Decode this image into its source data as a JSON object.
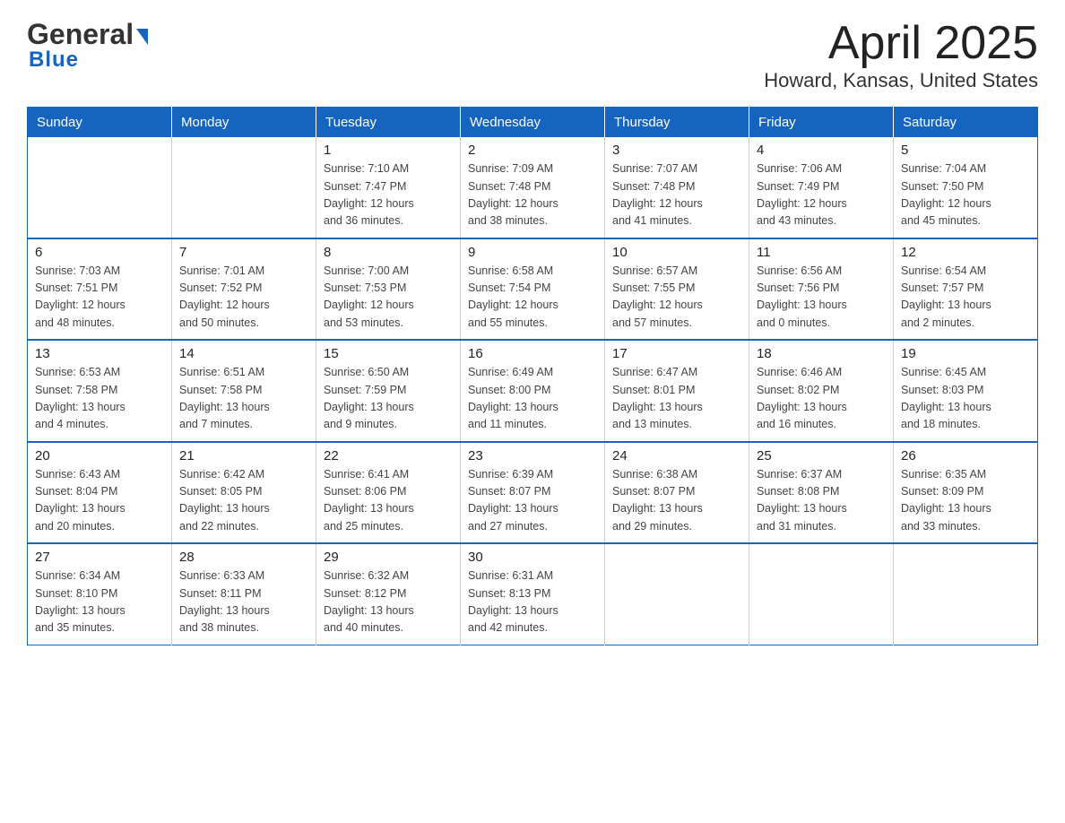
{
  "header": {
    "logo_general": "General",
    "logo_blue": "Blue",
    "title": "April 2025",
    "subtitle": "Howard, Kansas, United States"
  },
  "calendar": {
    "days_of_week": [
      "Sunday",
      "Monday",
      "Tuesday",
      "Wednesday",
      "Thursday",
      "Friday",
      "Saturday"
    ],
    "weeks": [
      [
        {
          "day": "",
          "detail": ""
        },
        {
          "day": "",
          "detail": ""
        },
        {
          "day": "1",
          "detail": "Sunrise: 7:10 AM\nSunset: 7:47 PM\nDaylight: 12 hours\nand 36 minutes."
        },
        {
          "day": "2",
          "detail": "Sunrise: 7:09 AM\nSunset: 7:48 PM\nDaylight: 12 hours\nand 38 minutes."
        },
        {
          "day": "3",
          "detail": "Sunrise: 7:07 AM\nSunset: 7:48 PM\nDaylight: 12 hours\nand 41 minutes."
        },
        {
          "day": "4",
          "detail": "Sunrise: 7:06 AM\nSunset: 7:49 PM\nDaylight: 12 hours\nand 43 minutes."
        },
        {
          "day": "5",
          "detail": "Sunrise: 7:04 AM\nSunset: 7:50 PM\nDaylight: 12 hours\nand 45 minutes."
        }
      ],
      [
        {
          "day": "6",
          "detail": "Sunrise: 7:03 AM\nSunset: 7:51 PM\nDaylight: 12 hours\nand 48 minutes."
        },
        {
          "day": "7",
          "detail": "Sunrise: 7:01 AM\nSunset: 7:52 PM\nDaylight: 12 hours\nand 50 minutes."
        },
        {
          "day": "8",
          "detail": "Sunrise: 7:00 AM\nSunset: 7:53 PM\nDaylight: 12 hours\nand 53 minutes."
        },
        {
          "day": "9",
          "detail": "Sunrise: 6:58 AM\nSunset: 7:54 PM\nDaylight: 12 hours\nand 55 minutes."
        },
        {
          "day": "10",
          "detail": "Sunrise: 6:57 AM\nSunset: 7:55 PM\nDaylight: 12 hours\nand 57 minutes."
        },
        {
          "day": "11",
          "detail": "Sunrise: 6:56 AM\nSunset: 7:56 PM\nDaylight: 13 hours\nand 0 minutes."
        },
        {
          "day": "12",
          "detail": "Sunrise: 6:54 AM\nSunset: 7:57 PM\nDaylight: 13 hours\nand 2 minutes."
        }
      ],
      [
        {
          "day": "13",
          "detail": "Sunrise: 6:53 AM\nSunset: 7:58 PM\nDaylight: 13 hours\nand 4 minutes."
        },
        {
          "day": "14",
          "detail": "Sunrise: 6:51 AM\nSunset: 7:58 PM\nDaylight: 13 hours\nand 7 minutes."
        },
        {
          "day": "15",
          "detail": "Sunrise: 6:50 AM\nSunset: 7:59 PM\nDaylight: 13 hours\nand 9 minutes."
        },
        {
          "day": "16",
          "detail": "Sunrise: 6:49 AM\nSunset: 8:00 PM\nDaylight: 13 hours\nand 11 minutes."
        },
        {
          "day": "17",
          "detail": "Sunrise: 6:47 AM\nSunset: 8:01 PM\nDaylight: 13 hours\nand 13 minutes."
        },
        {
          "day": "18",
          "detail": "Sunrise: 6:46 AM\nSunset: 8:02 PM\nDaylight: 13 hours\nand 16 minutes."
        },
        {
          "day": "19",
          "detail": "Sunrise: 6:45 AM\nSunset: 8:03 PM\nDaylight: 13 hours\nand 18 minutes."
        }
      ],
      [
        {
          "day": "20",
          "detail": "Sunrise: 6:43 AM\nSunset: 8:04 PM\nDaylight: 13 hours\nand 20 minutes."
        },
        {
          "day": "21",
          "detail": "Sunrise: 6:42 AM\nSunset: 8:05 PM\nDaylight: 13 hours\nand 22 minutes."
        },
        {
          "day": "22",
          "detail": "Sunrise: 6:41 AM\nSunset: 8:06 PM\nDaylight: 13 hours\nand 25 minutes."
        },
        {
          "day": "23",
          "detail": "Sunrise: 6:39 AM\nSunset: 8:07 PM\nDaylight: 13 hours\nand 27 minutes."
        },
        {
          "day": "24",
          "detail": "Sunrise: 6:38 AM\nSunset: 8:07 PM\nDaylight: 13 hours\nand 29 minutes."
        },
        {
          "day": "25",
          "detail": "Sunrise: 6:37 AM\nSunset: 8:08 PM\nDaylight: 13 hours\nand 31 minutes."
        },
        {
          "day": "26",
          "detail": "Sunrise: 6:35 AM\nSunset: 8:09 PM\nDaylight: 13 hours\nand 33 minutes."
        }
      ],
      [
        {
          "day": "27",
          "detail": "Sunrise: 6:34 AM\nSunset: 8:10 PM\nDaylight: 13 hours\nand 35 minutes."
        },
        {
          "day": "28",
          "detail": "Sunrise: 6:33 AM\nSunset: 8:11 PM\nDaylight: 13 hours\nand 38 minutes."
        },
        {
          "day": "29",
          "detail": "Sunrise: 6:32 AM\nSunset: 8:12 PM\nDaylight: 13 hours\nand 40 minutes."
        },
        {
          "day": "30",
          "detail": "Sunrise: 6:31 AM\nSunset: 8:13 PM\nDaylight: 13 hours\nand 42 minutes."
        },
        {
          "day": "",
          "detail": ""
        },
        {
          "day": "",
          "detail": ""
        },
        {
          "day": "",
          "detail": ""
        }
      ]
    ]
  }
}
